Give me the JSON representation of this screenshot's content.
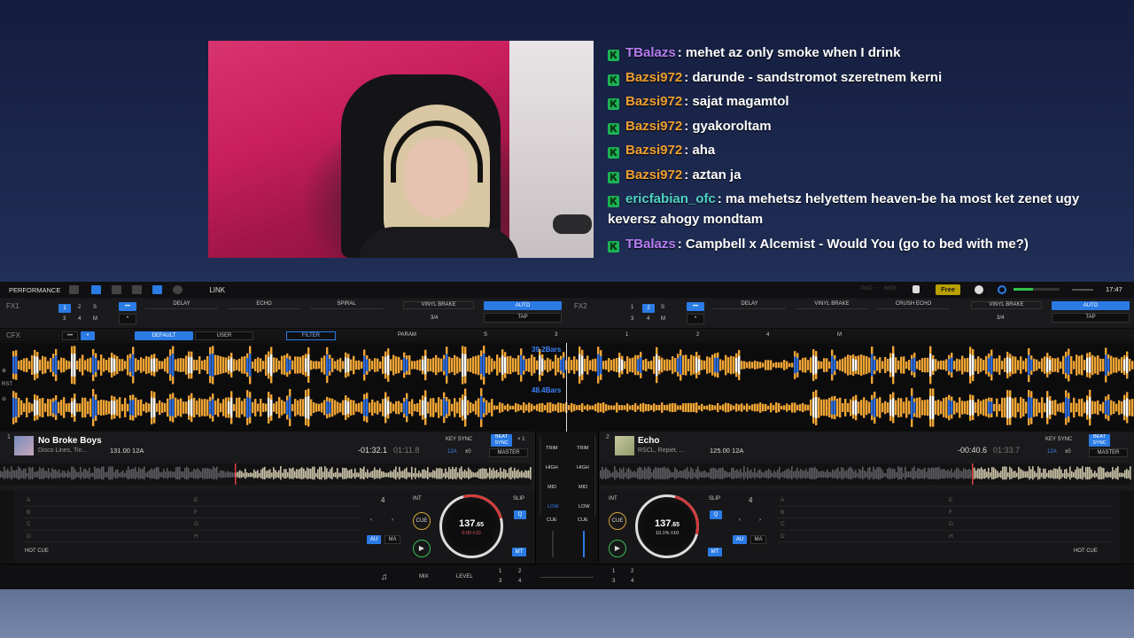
{
  "chat": {
    "messages": [
      {
        "user": "TBalazs",
        "color": "#b67cf0",
        "text": "mehet az only smoke when I drink"
      },
      {
        "user": "Bazsi972",
        "color": "#f0a030",
        "text": "darunde - sandstromot szeretnem kerni"
      },
      {
        "user": "Bazsi972",
        "color": "#f0a030",
        "text": "sajat magamtol"
      },
      {
        "user": "Bazsi972",
        "color": "#f0a030",
        "text": "gyakoroltam"
      },
      {
        "user": "Bazsi972",
        "color": "#f0a030",
        "text": "aha"
      },
      {
        "user": "Bazsi972",
        "color": "#f0a030",
        "text": "aztan ja"
      },
      {
        "user": "ericfabian_ofc",
        "color": "#4fd3c4",
        "text": "ma mehetsz helyettem heaven-be ha most ket zenet ugy keversz ahogy mondtam"
      },
      {
        "user": "TBalazs",
        "color": "#b67cf0",
        "text": "Campbell x Alcemist - Would You (go to bed with me?)"
      }
    ]
  },
  "app": {
    "topbar": {
      "mode": "PERFORMANCE",
      "link": "LINK",
      "pad": "PAD",
      "midi": "MIDI",
      "free": "Free",
      "clock": "17:47"
    },
    "fx1": {
      "label": "FX1",
      "slots": [
        "DELAY",
        "ECHO",
        "SPIRAL"
      ],
      "brake": "VINYL BRAKE",
      "beats": "3/4",
      "auto": "AUTO",
      "tap": "TAP"
    },
    "fx2": {
      "label": "FX2",
      "slots": [
        "DELAY",
        "VINYL BRAKE",
        "CRUSH ECHO"
      ],
      "brake": "VINYL BRAKE",
      "beats": "3/4",
      "auto": "AUTO",
      "tap": "TAP"
    },
    "cfx": {
      "label": "CFX",
      "tabs": [
        "DEFAULT",
        "USER"
      ],
      "filter": "FILTER",
      "param": "PARAM",
      "s": "S",
      "nums": [
        "3",
        "1",
        "2",
        "4"
      ],
      "m": "M"
    },
    "waves": {
      "top_bars": "39.2Bars",
      "bot_bars": "48.4Bars"
    },
    "deck1": {
      "number": "1",
      "title": "No Broke Boys",
      "artist": "Disco Lines, Tin...",
      "bpm_key": "131.00  12A",
      "remaining": "-01:32.1",
      "elapsed": "01:11.8",
      "key_sync": "KEY SYNC",
      "key": "12A",
      "key_shift": "±0",
      "beat_sync": "BEAT SYNC",
      "mult": "× 1",
      "master": "MASTER",
      "pads_left": [
        "A",
        "B",
        "C",
        "D"
      ],
      "pads_right": [
        "E",
        "F",
        "G",
        "H"
      ],
      "hot_cue": "HOT CUE",
      "loop": "4",
      "int": "INT",
      "cue": "CUE",
      "au": "AU",
      "ma": "MA",
      "slip": "SLIP",
      "q": "Q",
      "mt": "MT",
      "jog_bpm": "137",
      "jog_bpm_dec": ".65",
      "jog_pitch": "0.00  ±10"
    },
    "deck2": {
      "number": "2",
      "title": "Echo",
      "artist": "RSCL, Repiet, ...",
      "bpm_key": "125.00  12A",
      "remaining": "-00:40.6",
      "elapsed": "01:33.7",
      "key_sync": "KEY SYNC",
      "key": "12A",
      "key_shift": "±0",
      "beat_sync": "BEAT SYNC",
      "master": "MASTER",
      "pads_left": [
        "A",
        "B",
        "C",
        "D"
      ],
      "pads_right": [
        "E",
        "F",
        "G",
        "H"
      ],
      "hot_cue": "HOT CUE",
      "loop": "4",
      "int": "INT",
      "cue": "CUE",
      "au": "AU",
      "ma": "MA",
      "slip": "SLIP",
      "q": "Q",
      "mt": "MT",
      "jog_bpm": "137",
      "jog_bpm_dec": ".65",
      "jog_pitch": "10.1%  ±10"
    },
    "mixer": {
      "eq": [
        "TRIM",
        "HIGH",
        "MID",
        "LOW"
      ],
      "cue": "CUE"
    },
    "bottom": {
      "mix": "MIX",
      "level": "LEVEL",
      "grid": [
        "1",
        "2",
        "3",
        "4"
      ]
    }
  }
}
